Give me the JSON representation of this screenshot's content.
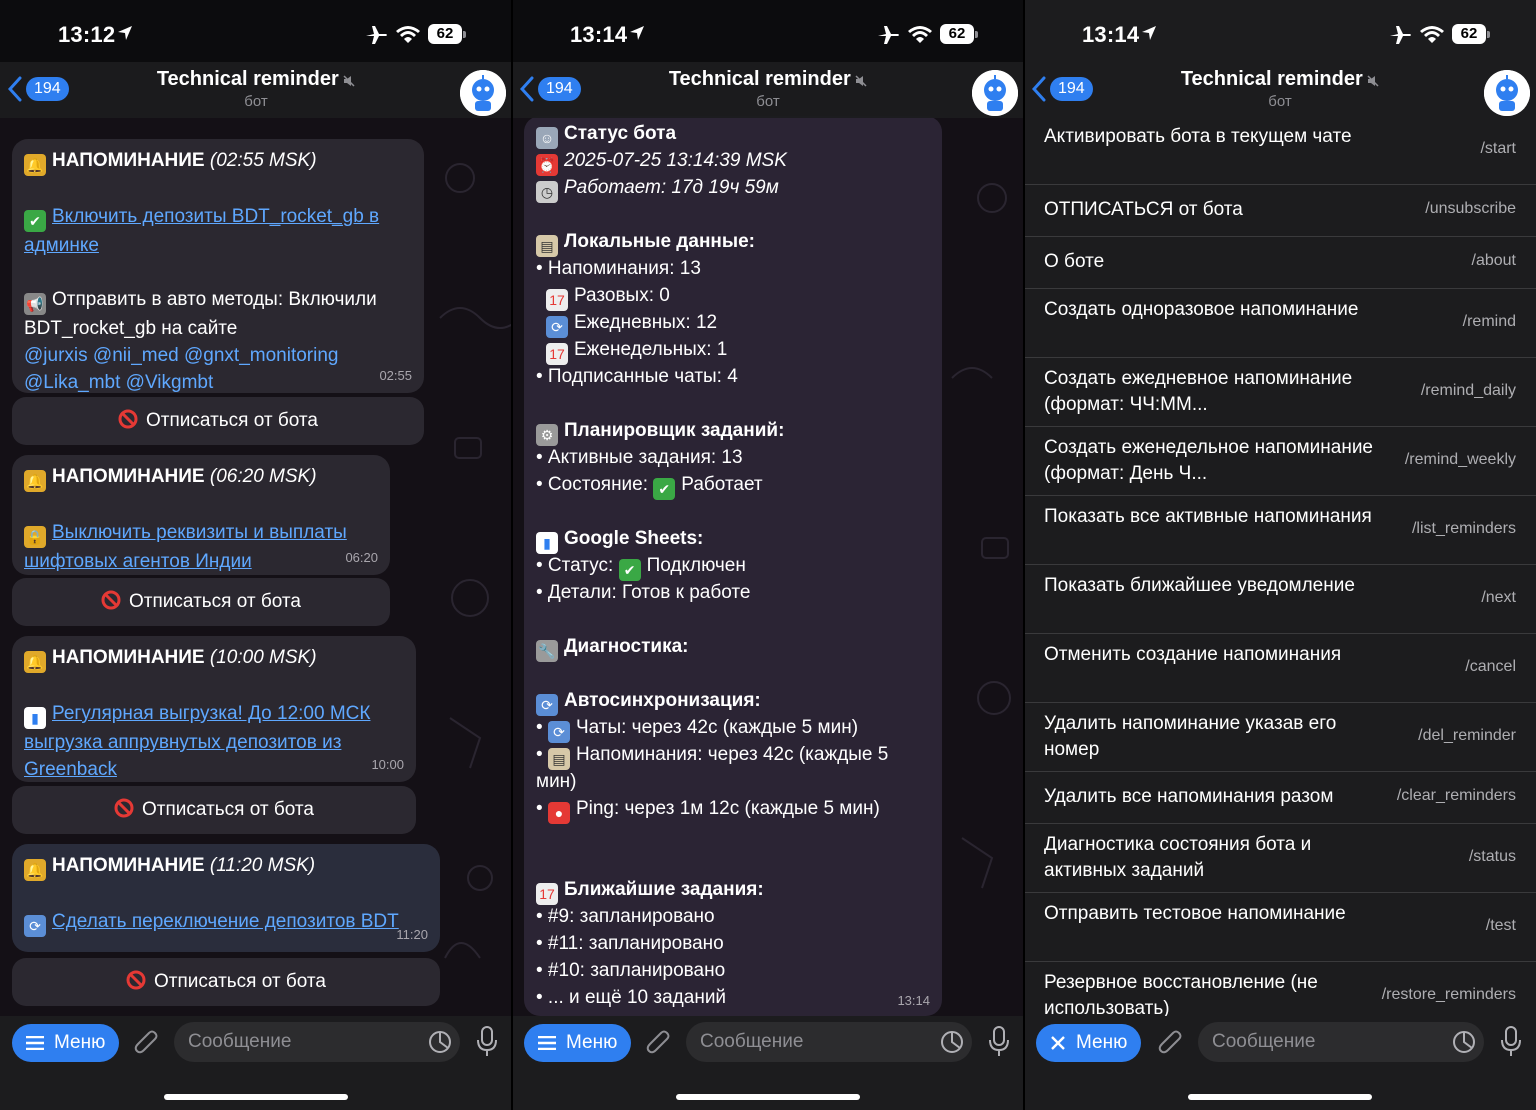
{
  "status_bar": [
    {
      "time": "13:12",
      "battery": "62"
    },
    {
      "time": "13:14",
      "battery": "62"
    },
    {
      "time": "13:14",
      "battery": "62"
    }
  ],
  "header": {
    "back_count": "194",
    "title": "Technical reminder",
    "subtitle": "бот"
  },
  "screen1": {
    "messages": [
      {
        "heading": "НАПОМИНАНИЕ",
        "time_tag": "(02:55 MSK)",
        "link": "Включить депозиты BDT_rocket_gb в админке",
        "body": "Отправить в авто методы: Включили BDT_rocket_gb на сайте",
        "mentions": "@jurxis @nii_med @gnxt_monitoring @Lika_mbt @Vikgmbt",
        "timestamp": "02:55"
      },
      {
        "heading": "НАПОМИНАНИЕ",
        "time_tag": "(06:20 MSK)",
        "link": "Выключить реквизиты и выплаты шифтовых агентов Индии",
        "timestamp": "06:20"
      },
      {
        "heading": "НАПОМИНАНИЕ",
        "time_tag": "(10:00 MSK)",
        "link": "Регулярная выгрузка! До 12:00 МСК выгрузка аппрувнутых депозитов из Greenback",
        "timestamp": "10:00"
      },
      {
        "heading": "НАПОМИНАНИЕ",
        "time_tag": "(11:20 MSK)",
        "link": "Сделать переключение депозитов BDT",
        "timestamp": "11:20"
      }
    ],
    "unsubscribe_label": "Отписаться от бота"
  },
  "screen2": {
    "lines": [
      "Статус бота",
      "2025-07-25 13:14:39 MSK",
      "Работает: 17д 19ч 59м",
      "",
      "Локальные данные:",
      "• Напоминания: 13",
      "Разовых: 0",
      "Ежедневных: 12",
      "Еженедельных: 1",
      "• Подписанные чаты: 4",
      "",
      "Планировщик заданий:",
      "• Активные задания: 13",
      "• Состояние:",
      "Работает",
      "",
      "Google Sheets:",
      "• Статус:",
      "Подключен",
      "• Детали: Готов к работе",
      "",
      "Диагностика:",
      "",
      "Автосинхронизация:",
      "Чаты: через 42с (каждые 5 мин)",
      "Напоминания: через 42с (каждые 5",
      "мин)",
      "Ping: через 1м 12с (каждые 5 мин)",
      "Ближайшие задания:",
      "• #9: запланировано",
      "• #11: запланировано",
      "• #10: запланировано",
      "• ... и ещё 10 заданий"
    ],
    "timestamp": "13:14"
  },
  "screen3": {
    "commands": [
      {
        "desc": "Активировать бота в текущем чате",
        "code": "/start"
      },
      {
        "desc": "ОТПИСАТЬСЯ от бота",
        "code": "/unsubscribe"
      },
      {
        "desc": "О боте",
        "code": "/about"
      },
      {
        "desc": "Создать одноразовое напоминание",
        "code": "/remind"
      },
      {
        "desc": "Создать ежедневное напоминание (формат: ЧЧ:ММ...",
        "code": "/remind_daily"
      },
      {
        "desc": "Создать еженедельное напоминание (формат: День Ч...",
        "code": "/remind_weekly"
      },
      {
        "desc": "Показать все активные напоминания",
        "code": "/list_reminders"
      },
      {
        "desc": "Показать ближайшее уведомление",
        "code": "/next"
      },
      {
        "desc": "Отменить создание напоминания",
        "code": "/cancel"
      },
      {
        "desc": "Удалить напоминание указав его номер",
        "code": "/del_reminder"
      },
      {
        "desc": "Удалить все напоминания разом",
        "code": "/clear_reminders"
      },
      {
        "desc": "Диагностика состояния бота и активных заданий",
        "code": "/status"
      },
      {
        "desc": "Отправить тестовое напоминание",
        "code": "/test"
      },
      {
        "desc": "Резервное восстановление (не использовать)",
        "code": "/restore_reminders"
      }
    ]
  },
  "input": {
    "menu_label": "Меню",
    "placeholder": "Сообщение"
  },
  "colors": {
    "accent": "#2f7ff0",
    "link": "#5fa8ff",
    "bubble": "#2b2830",
    "panel": "#1c1c1e"
  },
  "icons": [
    "location-arrow-icon",
    "airplane-icon",
    "wifi-icon",
    "back-chevron-icon",
    "mute-icon",
    "bot-avatar-icon",
    "bell-icon",
    "check-icon",
    "megaphone-icon",
    "lock-icon",
    "chart-icon",
    "refresh-icon",
    "no-entry-icon",
    "robot-icon",
    "alarm-icon",
    "stopwatch-icon",
    "clipboard-icon",
    "calendar-icon",
    "gear-icon",
    "wrench-icon",
    "ping-pong-icon",
    "hamburger-icon",
    "close-icon",
    "paperclip-icon",
    "sticker-icon",
    "microphone-icon"
  ]
}
